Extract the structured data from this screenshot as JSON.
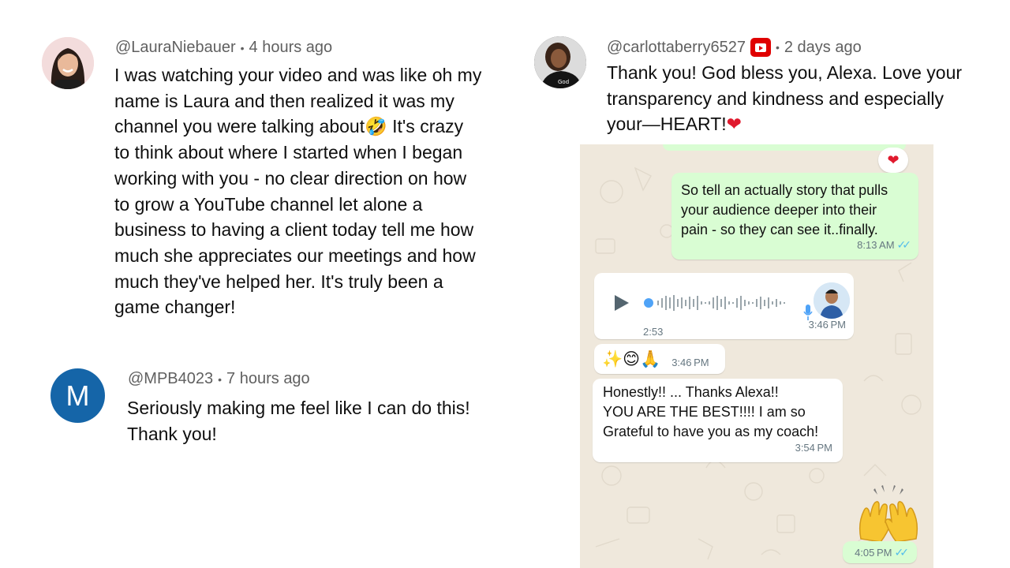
{
  "comments": [
    {
      "handle": "@LauraNiebauer",
      "time": "4 hours ago",
      "lines": [
        "I was watching your video and was like oh my",
        "name is Laura and then realized it was my",
        "channel you were talking about🤣 It's crazy",
        "to think about where I started when I began",
        "working with you - no clear direction on how",
        "to grow a YouTube channel let alone a",
        "business to having a client today tell me how",
        "much she appreciates our meetings and how",
        "much they've helped her. It's truly been a",
        "game changer!"
      ]
    },
    {
      "handle": "@MPB4023",
      "time": "7 hours ago",
      "avatar_letter": "M",
      "avatar_color": "#1565a8",
      "lines": [
        "Seriously making me feel like I can do this!",
        "Thank you!"
      ]
    },
    {
      "handle": "@carlottaberry6527",
      "time": "2 days ago",
      "lines": [
        "Thank you! God bless you, Alexa. Love your",
        "transparency and kindness and especially",
        "your—HEART!"
      ],
      "heart": "❤"
    }
  ],
  "chat": {
    "reaction": "❤",
    "msg1": {
      "lines": [
        "So tell an actually story that pulls",
        "your audience deeper into their",
        "pain - so they can see it..finally."
      ],
      "time": "8:13 AM"
    },
    "voice": {
      "duration": "2:53",
      "time": "3:46 PM"
    },
    "emoji_msg": {
      "text": "✨😊🙏",
      "time": "3:46 PM"
    },
    "msg2": {
      "lines": [
        "Honestly!! ... Thanks Alexa!!",
        "YOU ARE THE BEST!!!! I am so",
        "Grateful to have you as my coach!"
      ],
      "time": "3:54 PM"
    },
    "msg3": {
      "time": "4:05 PM"
    },
    "ticks": "✓✓"
  },
  "colors": {
    "accent_red": "#e0192d",
    "chat_bg": "#efe8dc",
    "outgoing_bubble": "#d9fdd3",
    "read_ticks": "#53bdeb"
  }
}
